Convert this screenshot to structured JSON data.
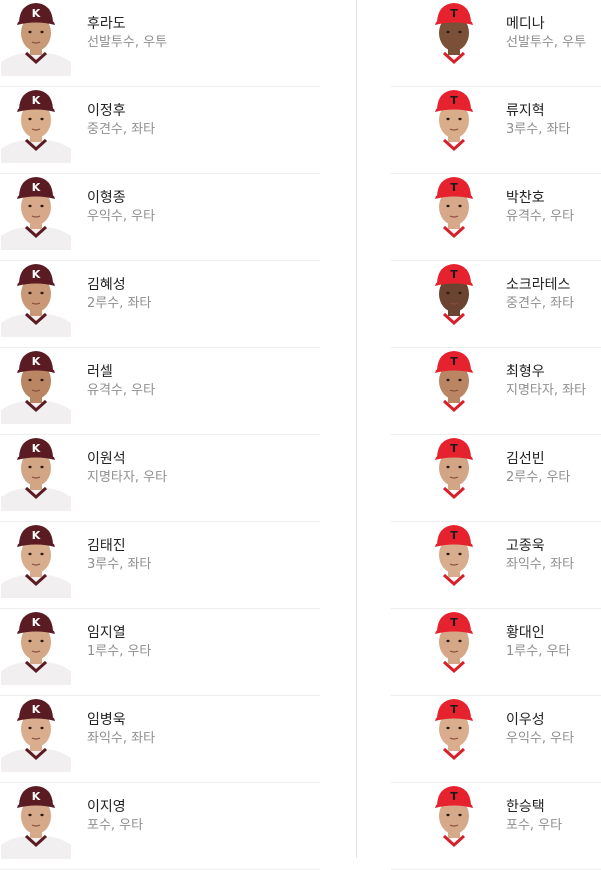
{
  "home": {
    "team_color": "#5a1b23",
    "cap_letter": "K",
    "players": [
      {
        "name": "후라도",
        "desc": "선발투수, 우투"
      },
      {
        "name": "이정후",
        "desc": "중견수, 좌타"
      },
      {
        "name": "이형종",
        "desc": "우익수, 우타"
      },
      {
        "name": "김혜성",
        "desc": "2루수, 좌타"
      },
      {
        "name": "러셀",
        "desc": "유격수, 우타"
      },
      {
        "name": "이원석",
        "desc": "지명타자, 우타"
      },
      {
        "name": "김태진",
        "desc": "3루수, 좌타"
      },
      {
        "name": "임지열",
        "desc": "1루수, 우타"
      },
      {
        "name": "임병욱",
        "desc": "좌익수, 좌타"
      },
      {
        "name": "이지영",
        "desc": "포수, 우타"
      }
    ]
  },
  "away": {
    "team_color": "#e6222e",
    "cap_letter": "T",
    "players": [
      {
        "name": "메디나",
        "desc": "선발투수, 우투"
      },
      {
        "name": "류지혁",
        "desc": "3루수, 좌타"
      },
      {
        "name": "박찬호",
        "desc": "유격수, 우타"
      },
      {
        "name": "소크라테스",
        "desc": "중견수, 좌타"
      },
      {
        "name": "최형우",
        "desc": "지명타자, 좌타"
      },
      {
        "name": "김선빈",
        "desc": "2루수, 우타"
      },
      {
        "name": "고종욱",
        "desc": "좌익수, 좌타"
      },
      {
        "name": "황대인",
        "desc": "1루수, 우타"
      },
      {
        "name": "이우성",
        "desc": "우익수, 우타"
      },
      {
        "name": "한승택",
        "desc": "포수, 우타"
      }
    ]
  }
}
